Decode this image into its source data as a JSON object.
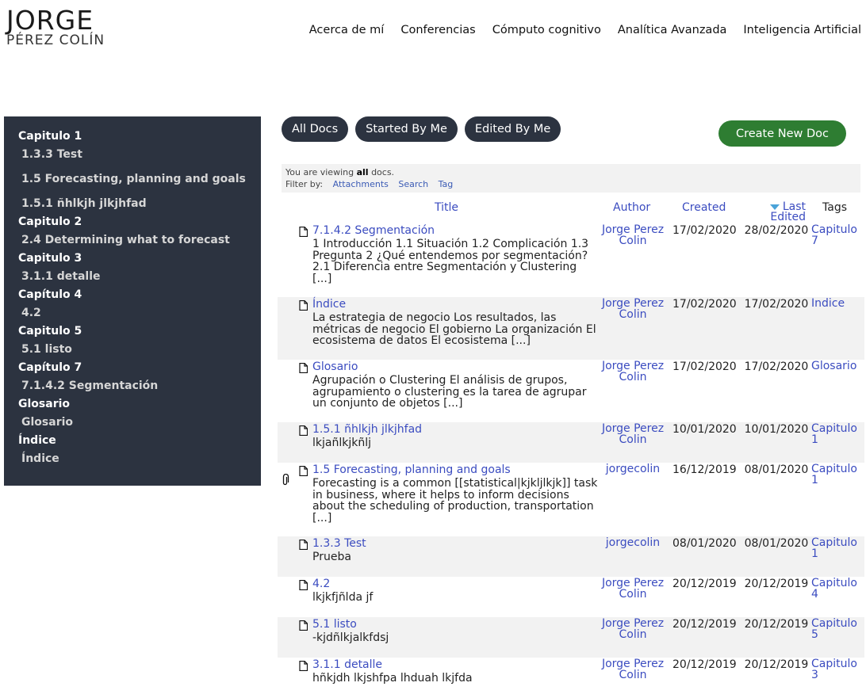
{
  "logo": {
    "name": "JORGE",
    "surname": "PÉREZ COLÍN"
  },
  "nav": [
    "Acerca de mí",
    "Conferencias",
    "Cómputo cognitivo",
    "Analítica Avanzada",
    "Inteligencia Artificial"
  ],
  "sidebar": [
    {
      "type": "chapter",
      "label": "Capitulo 1"
    },
    {
      "type": "item",
      "label": "1.3.3 Test"
    },
    {
      "type": "item",
      "label": "1.5 Forecasting, planning and goals",
      "gap": true
    },
    {
      "type": "item",
      "label": "1.5.1 ñhlkjh jlkjhfad",
      "gap": true
    },
    {
      "type": "chapter",
      "label": "Capitulo 2"
    },
    {
      "type": "item",
      "label": "2.4 Determining what to forecast"
    },
    {
      "type": "chapter",
      "label": "Capitulo 3"
    },
    {
      "type": "item",
      "label": "3.1.1 detalle"
    },
    {
      "type": "chapter",
      "label": "Capítulo 4"
    },
    {
      "type": "item",
      "label": "4.2"
    },
    {
      "type": "chapter",
      "label": "Capitulo 5"
    },
    {
      "type": "item",
      "label": "5.1 listo"
    },
    {
      "type": "chapter",
      "label": "Capítulo 7"
    },
    {
      "type": "item",
      "label": "7.1.4.2 Segmentación"
    },
    {
      "type": "chapter",
      "label": "Glosario"
    },
    {
      "type": "item",
      "label": "Glosario"
    },
    {
      "type": "chapter",
      "label": "Índice"
    },
    {
      "type": "item",
      "label": "Índice"
    }
  ],
  "filters": {
    "all_docs": "All Docs",
    "started_by_me": "Started By Me",
    "edited_by_me": "Edited By Me"
  },
  "create_button": "Create New Doc",
  "info": {
    "viewing_prefix": "You are viewing",
    "viewing_bold": "all",
    "viewing_suffix": "docs.",
    "filter_label": "Filter by:",
    "filter_links": [
      "Attachments",
      "Search",
      "Tag"
    ]
  },
  "columns": {
    "title": "Title",
    "author": "Author",
    "created": "Created",
    "edited_line1": "Last",
    "edited_line2": "Edited",
    "tags": "Tags",
    "sort_indicator_icon": "sort-desc-icon"
  },
  "rows": [
    {
      "title": "7.1.4.2 Segmentación",
      "excerpt": "1 Introducción 1.1 Situación 1.2 Complicación 1.3 Pregunta   2 ¿Qué entendemos por segmentación? 2.1 Diferencia entre Segmentación y Clustering [...]",
      "author": "Jorge Perez Colin",
      "created": "17/02/2020",
      "edited": "28/02/2020",
      "tag": "Capitulo 7",
      "attachment": false
    },
    {
      "title": "Índice",
      "excerpt": "La estrategia de negocio Los resultados, las métricas de negocio El gobierno La organización El ecosistema de datos El ecosistema [...]",
      "author": "Jorge Perez Colin",
      "created": "17/02/2020",
      "edited": "17/02/2020",
      "tag": "Índice",
      "attachment": false
    },
    {
      "title": "Glosario",
      "excerpt": "Agrupación o Clustering   El análisis de grupos, agrupamiento o clustering es la tarea de agrupar un conjunto de objetos [...]",
      "author": "Jorge Perez Colin",
      "created": "17/02/2020",
      "edited": "17/02/2020",
      "tag": "Glosario",
      "attachment": false
    },
    {
      "title": "1.5.1 ñhlkjh jlkjhfad",
      "excerpt": "lkjañlkjkñlj",
      "author": "Jorge Perez Colin",
      "created": "10/01/2020",
      "edited": "10/01/2020",
      "tag": "Capitulo 1",
      "attachment": false
    },
    {
      "title": "1.5 Forecasting, planning and goals",
      "excerpt": "Forecasting is a common [[statistical|kjkljlkjk]] task in business, where it helps to inform decisions about the scheduling of production, transportation [...]",
      "author": "jorgecolin",
      "created": "16/12/2019",
      "edited": "08/01/2020",
      "tag": "Capitulo 1",
      "attachment": true
    },
    {
      "title": "1.3.3 Test",
      "excerpt": "Prueba",
      "author": "jorgecolin",
      "created": "08/01/2020",
      "edited": "08/01/2020",
      "tag": "Capitulo 1",
      "attachment": false
    },
    {
      "title": "4.2",
      "excerpt": "lkjkfjñlda jf",
      "author": "Jorge Perez Colin",
      "created": "20/12/2019",
      "edited": "20/12/2019",
      "tag": "Capitulo 4",
      "attachment": false
    },
    {
      "title": "5.1 listo",
      "excerpt": "-kjdñlkjalkfdsj",
      "author": "Jorge Perez Colin",
      "created": "20/12/2019",
      "edited": "20/12/2019",
      "tag": "Capitulo 5",
      "attachment": false
    },
    {
      "title": "3.1.1 detalle",
      "excerpt": "hñkjdh lkjshfpa lhduah lkjfda",
      "author": "Jorge Perez Colin",
      "created": "20/12/2019",
      "edited": "20/12/2019",
      "tag": "Capitulo 3",
      "attachment": false
    }
  ]
}
